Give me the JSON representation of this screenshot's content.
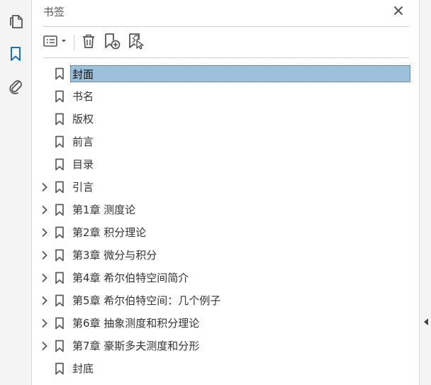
{
  "panel": {
    "title": "书签"
  },
  "icons": {
    "rail": [
      "pages-icon",
      "bookmarks-icon",
      "attachments-icon"
    ],
    "toolbar": [
      "options-menu-icon",
      "delete-bookmark-icon",
      "new-bookmark-icon",
      "new-bookmark-from-structure-icon"
    ],
    "close": "close-icon",
    "collapse": "collapse-arrow-icon"
  },
  "colors": {
    "accent": "#1f6fbf",
    "selection": "#9dc1da",
    "icon_gray": "#555555"
  },
  "bookmarks": [
    {
      "label": "封面",
      "expandable": false,
      "selected": true
    },
    {
      "label": "书名",
      "expandable": false,
      "selected": false
    },
    {
      "label": "版权",
      "expandable": false,
      "selected": false
    },
    {
      "label": "前言",
      "expandable": false,
      "selected": false
    },
    {
      "label": "目录",
      "expandable": false,
      "selected": false
    },
    {
      "label": "引言",
      "expandable": true,
      "selected": false
    },
    {
      "label": "第1章  测度论",
      "expandable": true,
      "selected": false
    },
    {
      "label": "第2章  积分理论",
      "expandable": true,
      "selected": false
    },
    {
      "label": "第3章  微分与积分",
      "expandable": true,
      "selected": false
    },
    {
      "label": "第4章  希尔伯特空间简介",
      "expandable": true,
      "selected": false
    },
    {
      "label": "第5章  希尔伯特空间：几个例子",
      "expandable": true,
      "selected": false
    },
    {
      "label": "第6章  抽象测度和积分理论",
      "expandable": true,
      "selected": false
    },
    {
      "label": "第7章  豪斯多夫测度和分形",
      "expandable": true,
      "selected": false
    },
    {
      "label": "封底",
      "expandable": false,
      "selected": false
    }
  ]
}
